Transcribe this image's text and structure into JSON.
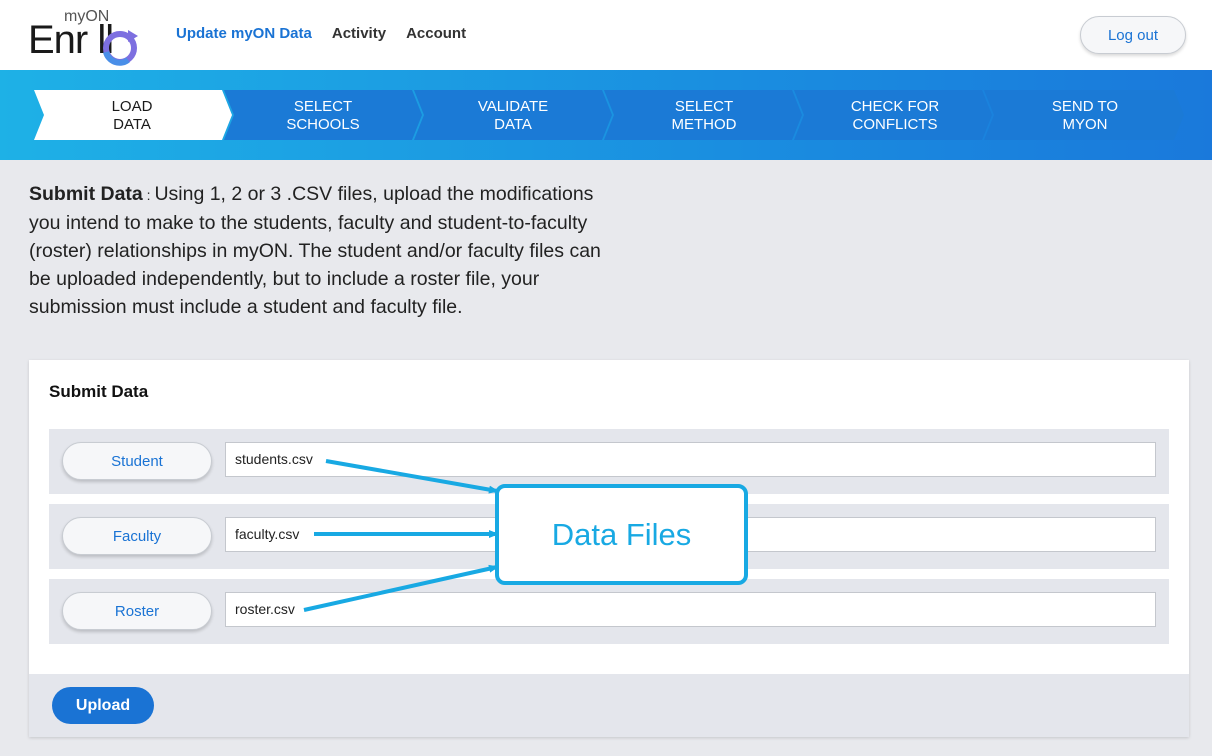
{
  "header": {
    "logo_small": "myON",
    "logo_big": "Enr   ll",
    "nav": [
      {
        "label": "Update myON Data",
        "active": true
      },
      {
        "label": "Activity",
        "active": false
      },
      {
        "label": "Account",
        "active": false
      }
    ],
    "logout_label": "Log out"
  },
  "steps": [
    {
      "label": "LOAD\nDATA",
      "active": true
    },
    {
      "label": "SELECT\nSCHOOLS",
      "active": false
    },
    {
      "label": "VALIDATE\nDATA",
      "active": false
    },
    {
      "label": "SELECT\nMETHOD",
      "active": false
    },
    {
      "label": "CHECK FOR\nCONFLICTS",
      "active": false
    },
    {
      "label": "SEND TO\nMYON",
      "active": false
    }
  ],
  "intro": {
    "title": "Submit Data",
    "separator": " : ",
    "text": "Using 1, 2 or 3 .CSV files, upload the modifications you intend to make to the students, faculty and student-to-faculty (roster) relationships in myON. The student and/or faculty files can be uploaded independently, but to include a roster file, your submission must include a student and faculty file."
  },
  "card": {
    "title": "Submit Data",
    "files": [
      {
        "button": "Student",
        "value": "students.csv"
      },
      {
        "button": "Faculty",
        "value": "faculty.csv"
      },
      {
        "button": "Roster",
        "value": "roster.csv"
      }
    ],
    "upload_label": "Upload"
  },
  "annotation": {
    "label": "Data Files"
  },
  "colors": {
    "accent": "#1a73d4",
    "stepper": "#1a8ee0",
    "callout": "#18a9e3"
  }
}
